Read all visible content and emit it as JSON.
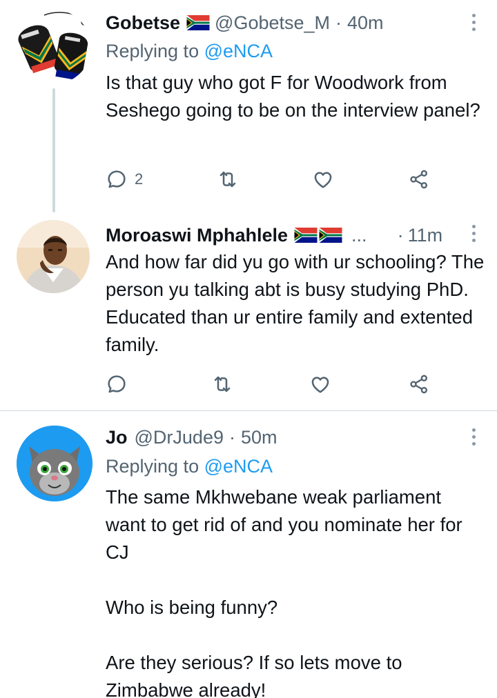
{
  "tweets": [
    {
      "name": "Gobetse",
      "handle": "@Gobetse_M",
      "separator": "·",
      "time": "40m",
      "replying_prefix": "Replying to ",
      "replying_to": "@eNCA",
      "text": "Is that guy who got F for Woodwork from Seshego going to be on the interview panel?",
      "reply_count": "2",
      "avatar_icon": "boxing-gloves-sa-flag-avatar"
    },
    {
      "name": "Moroaswi Mphahlele",
      "handle_truncated": "...",
      "separator": "·",
      "time": "11m",
      "text": "And how far did yu go with ur schooling? The person yu talking abt is busy studying PhD.  Educated than ur entire family and extented family.",
      "reply_count": "",
      "avatar_icon": "man-portrait-avatar"
    },
    {
      "name": "Jo",
      "handle": "@DrJude9",
      "separator": "·",
      "time": "50m",
      "replying_prefix": "Replying to ",
      "replying_to": "@eNCA",
      "text": "The same Mkhwebane weak parliament want to get rid of and you nominate her for CJ\n\nWho is being funny?\n\nAre they serious? If so lets move to Zimbabwe already!",
      "avatar_icon": "talking-tom-cat-avatar"
    }
  ],
  "colors": {
    "accent": "#1d9bf0",
    "secondary_text": "#536471",
    "divider": "#cfd9de"
  },
  "icons": {
    "reply": "reply-icon",
    "retweet": "retweet-icon",
    "like": "heart-icon",
    "share": "share-icon",
    "more": "more-options-icon",
    "flag": "south-africa-flag-icon"
  }
}
